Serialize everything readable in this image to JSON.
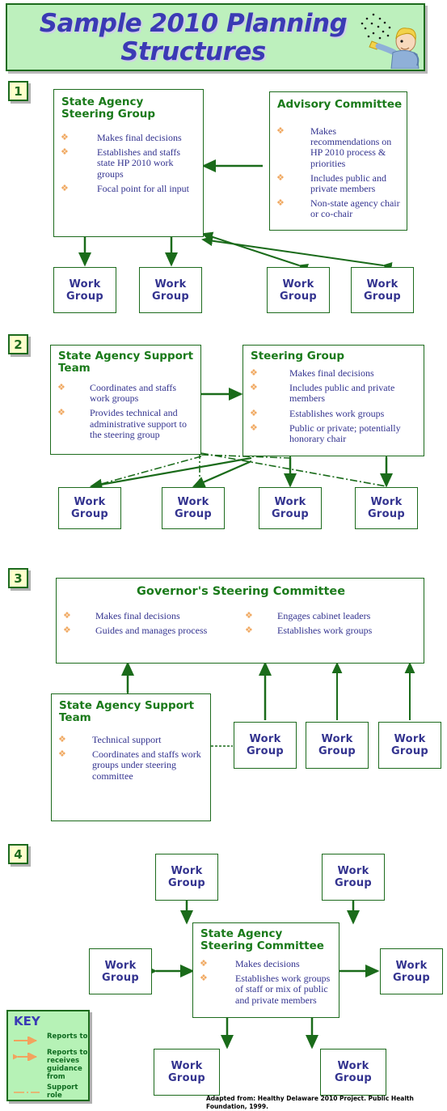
{
  "title": {
    "line1": "Sample 2010 Planning",
    "line2": "Structures"
  },
  "colors": {
    "banner_bg": "#bdf0bd",
    "border_green": "#1d6b1d",
    "heading_green": "#1a7a1a",
    "body_blue": "#33338f",
    "title_blue": "#3a3ab4",
    "bullet_orange": "#f0a860",
    "arrow_green": "#1a6b1a",
    "key_bg": "#b6f2b6",
    "badge_bg": "#ffffcc"
  },
  "work_group_label": "Work\nGroup",
  "sections": [
    {
      "number": "1",
      "boxes": [
        {
          "heading": "State Agency\nSteering Group",
          "bullets": [
            "Makes final decisions",
            "Establishes and staffs state HP 2010 work groups",
            "Focal point for all input"
          ]
        },
        {
          "heading": "Advisory Committee",
          "bullets": [
            "Makes recommendations on HP 2010 process & priorities",
            "Includes public and private members",
            "Non-state agency chair or co-chair"
          ]
        }
      ],
      "work_groups": [
        "Work Group",
        "Work Group",
        "Work Group",
        "Work Group"
      ]
    },
    {
      "number": "2",
      "boxes": [
        {
          "heading": "State Agency Support\nTeam",
          "bullets": [
            "Coordinates and staffs work groups",
            "Provides technical and administrative support to the steering group"
          ]
        },
        {
          "heading": "Steering Group",
          "bullets": [
            "Makes final decisions",
            "Includes public and private members",
            "Establishes work groups",
            "Public or private; potentially honorary chair"
          ]
        }
      ],
      "work_groups": [
        "Work Group",
        "Work Group",
        "Work Group",
        "Work Group"
      ]
    },
    {
      "number": "3",
      "boxes": [
        {
          "heading": "Governor's Steering Committee",
          "bullets_left": [
            "Makes final decisions",
            "Guides and manages process"
          ],
          "bullets_right": [
            "Engages cabinet leaders",
            "Establishes work groups"
          ]
        },
        {
          "heading": "State Agency Support\nTeam",
          "bullets": [
            "Technical support",
            "Coordinates and staffs work groups under steering committee"
          ]
        }
      ],
      "work_groups": [
        "Work Group",
        "Work Group",
        "Work Group"
      ]
    },
    {
      "number": "4",
      "boxes": [
        {
          "heading": "State Agency\nSteering Committee",
          "bullets": [
            "Makes decisions",
            "Establishes work groups of staff or mix of public and private members"
          ]
        }
      ],
      "work_groups": [
        "Work Group",
        "Work Group",
        "Work Group",
        "Work Group",
        "Work Group",
        "Work Group"
      ]
    }
  ],
  "key": {
    "title": "KEY",
    "items": [
      {
        "label": "Reports to",
        "style": "single-arrow"
      },
      {
        "label": "Reports to, receives guidance from",
        "style": "double-arrow"
      },
      {
        "label": "Support role",
        "style": "dashed-line"
      }
    ]
  },
  "footer": "Adapted from: Healthy Delaware 2010 Project. Public Health Foundation, 1999."
}
